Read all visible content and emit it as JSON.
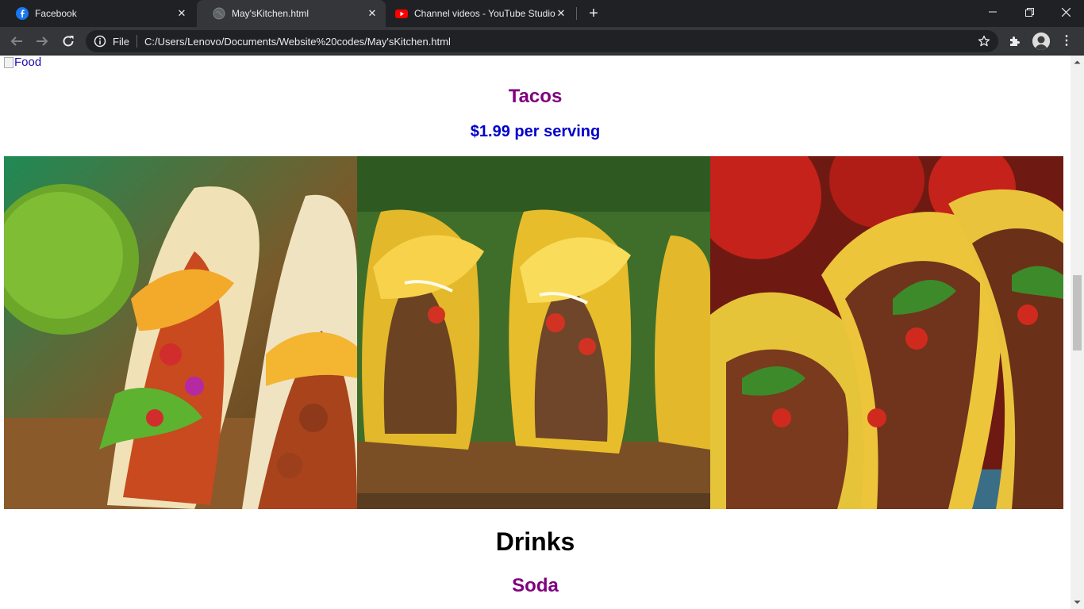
{
  "browser": {
    "tabs": [
      {
        "title": "Facebook",
        "icon": "facebook-icon",
        "active": false
      },
      {
        "title": "May'sKitchen.html",
        "icon": "globe-icon",
        "active": true
      },
      {
        "title": "Channel videos - YouTube Studio",
        "icon": "youtube-icon",
        "active": false
      }
    ],
    "address": {
      "scheme_label": "File",
      "url": "C:/Users/Lenovo/Documents/Website%20codes/May'sKitchen.html"
    },
    "colors": {
      "tabbar": "#202124",
      "toolbar": "#35363a",
      "text": "#e8eaed"
    }
  },
  "page": {
    "broken_image_alt": "Food",
    "dish": {
      "name": "Tacos",
      "price": "$1.99 per serving",
      "photos": [
        "taco-photo-1",
        "taco-photo-2",
        "taco-photo-3"
      ]
    },
    "section": {
      "title": "Drinks"
    },
    "next_dish": {
      "name": "Soda"
    },
    "colors": {
      "dish_title": "#800080",
      "price": "#0000cd",
      "section_title": "#000000"
    }
  }
}
